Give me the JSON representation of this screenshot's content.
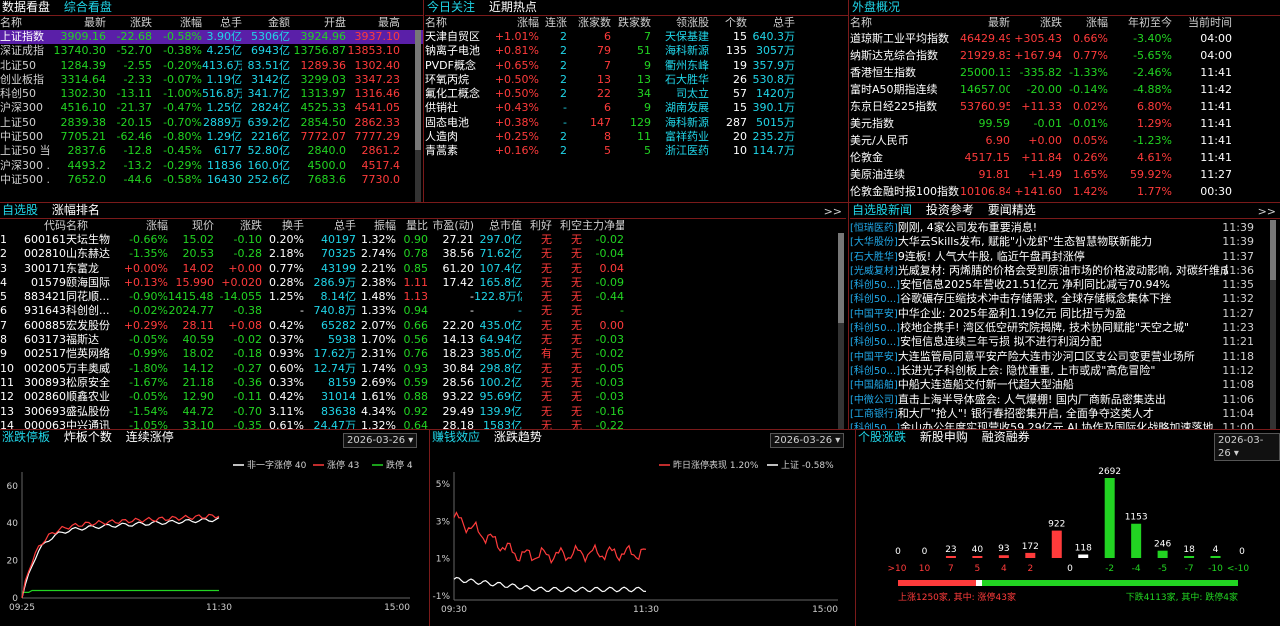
{
  "panels": {
    "overview": {
      "tabs": [
        "数据看盘",
        "综合看盘"
      ],
      "headers": [
        "名称",
        "最新",
        "涨跌",
        "涨幅",
        "总手",
        "金额",
        "开盘",
        "最高"
      ],
      "rows": [
        [
          "上证指数",
          "3909.16",
          "-22.68",
          "-0.58%",
          "3.90亿",
          "5306亿",
          "3924.96",
          "3937.10"
        ],
        [
          "深证成指",
          "13740.30",
          "-52.70",
          "-0.38%",
          "4.25亿",
          "6943亿",
          "13756.87",
          "13853.10"
        ],
        [
          "北证50",
          "1284.39",
          "-2.55",
          "-0.20%",
          "413.6万",
          "83.51亿",
          "1289.36",
          "1302.40"
        ],
        [
          "创业板指",
          "3314.64",
          "-2.33",
          "-0.07%",
          "1.19亿",
          "3142亿",
          "3299.03",
          "3347.23"
        ],
        [
          "科创50",
          "1302.30",
          "-13.11",
          "-1.00%",
          "516.8万",
          "341.7亿",
          "1313.97",
          "1316.46"
        ],
        [
          "沪深300",
          "4516.10",
          "-21.37",
          "-0.47%",
          "1.25亿",
          "2824亿",
          "4525.33",
          "4541.05"
        ],
        [
          "上证50",
          "2839.38",
          "-20.15",
          "-0.70%",
          "2889万",
          "639.2亿",
          "2854.50",
          "2862.33"
        ],
        [
          "中证500",
          "7705.21",
          "-62.46",
          "-0.80%",
          "1.29亿",
          "2216亿",
          "7772.07",
          "7777.29"
        ],
        [
          "上证50 当...",
          "2837.6",
          "-12.8",
          "-0.45%",
          "6177",
          "52.80亿",
          "2840.0",
          "2861.2"
        ],
        [
          "沪深300 ...",
          "4493.2",
          "-13.2",
          "-0.29%",
          "11836",
          "160.0亿",
          "4500.0",
          "4517.4"
        ],
        [
          "中证500 ...",
          "7652.0",
          "-44.6",
          "-0.58%",
          "16430",
          "252.6亿",
          "7683.6",
          "7730.0"
        ]
      ]
    },
    "hot": {
      "tabs": [
        "今日关注",
        "近期热点"
      ],
      "headers": [
        "名称",
        "涨幅",
        "连涨",
        "涨家数",
        "跌家数",
        "领涨股",
        "个数",
        "总手"
      ],
      "rows": [
        [
          "天津自贸区",
          "+1.01%",
          "2",
          "6",
          "7",
          "天保基建",
          "15",
          "640.3万"
        ],
        [
          "钠离子电池",
          "+0.81%",
          "2",
          "79",
          "51",
          "海科新源",
          "135",
          "3057万"
        ],
        [
          "PVDF概念",
          "+0.65%",
          "2",
          "7",
          "9",
          "衢州东峰",
          "19",
          "357.9万"
        ],
        [
          "环氧丙烷",
          "+0.50%",
          "2",
          "13",
          "13",
          "石大胜华",
          "26",
          "530.8万"
        ],
        [
          "氟化工概念",
          "+0.50%",
          "2",
          "22",
          "34",
          "司太立",
          "57",
          "1420万"
        ],
        [
          "供销社",
          "+0.43%",
          "-",
          "6",
          "9",
          "湖南发展",
          "15",
          "390.1万"
        ],
        [
          "固态电池",
          "+0.38%",
          "-",
          "147",
          "129",
          "海科新源",
          "287",
          "5015万"
        ],
        [
          "人造肉",
          "+0.25%",
          "2",
          "8",
          "11",
          "富祥药业",
          "20",
          "235.2万"
        ],
        [
          "青蒿素",
          "+0.16%",
          "2",
          "5",
          "5",
          "浙江医药",
          "10",
          "114.7万"
        ]
      ]
    },
    "global": {
      "tabs": [
        "外盘概况"
      ],
      "headers": [
        "名称",
        "最新",
        "涨跌",
        "涨幅",
        "年初至今",
        "当前时间"
      ],
      "rows": [
        [
          "道琼斯工业平均指数",
          "46429.49",
          "+305.43",
          "0.66%",
          "-3.40%",
          "04:00"
        ],
        [
          "纳斯达克综合指数",
          "21929.83",
          "+167.94",
          "0.77%",
          "-5.65%",
          "04:00"
        ],
        [
          "香港恒生指数",
          "25000.13",
          "-335.82",
          "-1.33%",
          "-2.46%",
          "11:41"
        ],
        [
          "富时A50期指连续",
          "14657.00",
          "-20.00",
          "-0.14%",
          "-4.88%",
          "11:42"
        ],
        [
          "东京日经225指数",
          "53760.95",
          "+11.33",
          "0.02%",
          "6.80%",
          "11:41"
        ],
        [
          "美元指数",
          "99.59",
          "-0.01",
          "-0.01%",
          "1.29%",
          "11:41"
        ],
        [
          "美元/人民币",
          "6.90",
          "+0.00",
          "0.05%",
          "-1.23%",
          "11:41"
        ],
        [
          "伦敦金",
          "4517.15",
          "+11.84",
          "0.26%",
          "4.61%",
          "11:41"
        ],
        [
          "美原油连续",
          "91.81",
          "+1.49",
          "1.65%",
          "59.92%",
          "11:27"
        ],
        [
          "伦敦金融时报100指数",
          "10106.84",
          "+141.60",
          "1.42%",
          "1.77%",
          "00:30"
        ]
      ]
    },
    "watch": {
      "tabs": [
        "自选股",
        "涨幅排名"
      ],
      "more": ">>",
      "headers": [
        "",
        "代码",
        "名称",
        "涨幅",
        "现价",
        "涨跌",
        "换手",
        "总手",
        "振幅",
        "量比",
        "市盈(动)",
        "总市值",
        "利好",
        "利空",
        "主力净量"
      ],
      "rows": [
        [
          "1",
          "600161",
          "天坛生物",
          "-0.66%",
          "15.02",
          "-0.10",
          "0.20%",
          "40197",
          "1.32%",
          "0.90",
          "27.21",
          "297.0亿",
          "无",
          "无",
          "-0.02"
        ],
        [
          "2",
          "002810",
          "山东赫达",
          "-1.35%",
          "20.53",
          "-0.28",
          "2.18%",
          "70325",
          "2.74%",
          "0.78",
          "38.56",
          "71.62亿",
          "无",
          "无",
          "-0.04"
        ],
        [
          "3",
          "300171",
          "东富龙",
          "+0.00%",
          "14.02",
          "+0.00",
          "0.77%",
          "43199",
          "2.21%",
          "0.85",
          "61.20",
          "107.4亿",
          "无",
          "无",
          "0.04"
        ],
        [
          "4",
          "01579",
          "颐海国际",
          "+0.13%",
          "15.990",
          "+0.020",
          "0.28%",
          "286.9万",
          "2.38%",
          "1.11",
          "17.42",
          "165.8亿",
          "无",
          "无",
          "-0.09"
        ],
        [
          "5",
          "883421",
          "同花顺...",
          "-0.90%",
          "1415.484",
          "-14.055",
          "1.25%",
          "8.14亿",
          "1.48%",
          "1.13",
          "-",
          "122.8万亿",
          "无",
          "无",
          "-0.44"
        ],
        [
          "6",
          "931643",
          "科创创...",
          "-0.02%",
          "2024.77",
          "-0.38",
          "-",
          "740.8万",
          "1.33%",
          "0.94",
          "-",
          "-",
          "无",
          "无",
          "-"
        ],
        [
          "7",
          "600885",
          "宏发股份",
          "+0.29%",
          "28.11",
          "+0.08",
          "0.42%",
          "65282",
          "2.07%",
          "0.66",
          "22.20",
          "435.0亿",
          "无",
          "无",
          "0.00"
        ],
        [
          "8",
          "603173",
          "福斯达",
          "-0.05%",
          "40.59",
          "-0.02",
          "0.37%",
          "5938",
          "1.70%",
          "0.56",
          "14.13",
          "64.94亿",
          "无",
          "无",
          "-0.03"
        ],
        [
          "9",
          "002517",
          "恺英网络",
          "-0.99%",
          "18.02",
          "-0.18",
          "0.93%",
          "17.62万",
          "2.31%",
          "0.76",
          "18.23",
          "385.0亿",
          "有",
          "无",
          "-0.02"
        ],
        [
          "10",
          "002005",
          "万丰奥威",
          "-1.80%",
          "14.12",
          "-0.27",
          "0.60%",
          "12.74万",
          "1.74%",
          "0.93",
          "30.84",
          "298.8亿",
          "无",
          "无",
          "-0.05"
        ],
        [
          "11",
          "300893",
          "松原安全",
          "-1.67%",
          "21.18",
          "-0.36",
          "0.33%",
          "8159",
          "2.69%",
          "0.59",
          "28.56",
          "100.2亿",
          "无",
          "无",
          "-0.03"
        ],
        [
          "12",
          "002860",
          "顺鑫农业",
          "-0.05%",
          "12.90",
          "-0.11",
          "0.42%",
          "31014",
          "1.61%",
          "0.88",
          "93.22",
          "95.69亿",
          "无",
          "无",
          "-0.03"
        ],
        [
          "13",
          "300693",
          "盛弘股份",
          "-1.54%",
          "44.72",
          "-0.70",
          "3.11%",
          "83638",
          "4.34%",
          "0.92",
          "29.49",
          "139.9亿",
          "无",
          "无",
          "-0.16"
        ],
        [
          "14",
          "000063",
          "中兴通讯",
          "-1.05%",
          "33.10",
          "-0.35",
          "0.61%",
          "24.47万",
          "1.32%",
          "0.64",
          "28.18",
          "1583亿",
          "无",
          "无",
          "-0.22"
        ]
      ]
    },
    "news": {
      "tabs": [
        "自选股新闻",
        "投资参考",
        "要闻精选"
      ],
      "more": ">>",
      "rows": [
        [
          "[恒瑞医药]",
          "刚刚, 4家公司发布重要消息!",
          "11:39"
        ],
        [
          "[大华股份]",
          "大华云Skills发布, 赋能\"小龙虾\"生态智慧物联新能力",
          "11:39"
        ],
        [
          "[石大胜华]",
          "9连板! 人气大牛股, 临近午盘再封涨停",
          "11:37"
        ],
        [
          "[光威复材]",
          "光威复材: 丙烯腈的价格会受到原油市场的价格波动影响, 对碳纤维成本控...",
          "11:36"
        ],
        [
          "[科创50...]",
          "安恒信息2025年营收21.51亿元 净利同比减亏70.94%",
          "11:35"
        ],
        [
          "[科创50...]",
          "谷歌碾存压缩技术冲击存储需求, 全球存储概念集体下挫",
          "11:32"
        ],
        [
          "[中国平安]",
          "中华企业: 2025年盈利1.19亿元 同比扭亏为盈",
          "11:27"
        ],
        [
          "[科创50...]",
          "校地企携手! 湾区低空研究院揭牌, 技术协同赋能\"天空之城\"",
          "11:23"
        ],
        [
          "[科创50...]",
          "安恒信息连续三年亏损 拟不进行利润分配",
          "11:21"
        ],
        [
          "[中国平安]",
          "大连监管局同意平安产险大连市沙河口区支公司变更营业场所",
          "11:18"
        ],
        [
          "[科创50...]",
          "长进光子科创板上会: 隐忧重重, 上市或成\"高危冒险\"",
          "11:12"
        ],
        [
          "[中国船舶]",
          "中船大连造船交付新一代超大型油船",
          "11:08"
        ],
        [
          "[中微公司]",
          "直击上海半导体盛会: 人气爆棚! 国内厂商新品密集迭出",
          "11:06"
        ],
        [
          "[工商银行]",
          "和大厂\"抢人\"! 银行春招密集开启, 全面争夺这类人才",
          "11:04"
        ],
        [
          "[科创50...]",
          "金山办公年度实现营收59.29亿元 AI 协作及国际化战略加速落地",
          "11:00"
        ]
      ]
    },
    "limit": {
      "tabs": [
        "涨跌停板",
        "炸板个数",
        "连续涨停"
      ],
      "date": "2026-03-26",
      "legend": [
        {
          "name": "非一字涨停 40",
          "color": "#ffffff"
        },
        {
          "name": "涨停 43",
          "color": "#ff3b3b"
        },
        {
          "name": "跌停 4",
          "color": "#22d422"
        }
      ],
      "yticks": [
        "60",
        "40",
        "20",
        "0"
      ],
      "xticks": [
        "09:25",
        "11:30",
        "15:00"
      ]
    },
    "effect": {
      "tabs": [
        "赚钱效应",
        "涨跌趋势"
      ],
      "date": "2026-03-26",
      "legend": [
        {
          "name": "昨日涨停表现 1.20%",
          "color": "#ff3b3b"
        },
        {
          "name": "上证 -0.58%",
          "color": "#ffffff"
        }
      ],
      "yticks": [
        "5%",
        "3%",
        "1%",
        "-1%"
      ],
      "xticks": [
        "09:30",
        "11:30",
        "15:00"
      ]
    },
    "dist": {
      "tabs": [
        "个股涨跌",
        "新股申购",
        "融资融券"
      ],
      "date": "2026-03-26",
      "bars": [
        {
          "v": 0,
          "c": "#ff3b3b"
        },
        {
          "v": 0,
          "c": "#ff3b3b"
        },
        {
          "v": 23,
          "c": "#ff3b3b"
        },
        {
          "v": 40,
          "c": "#ff3b3b"
        },
        {
          "v": 93,
          "c": "#ff3b3b"
        },
        {
          "v": 172,
          "c": "#ff3b3b"
        },
        {
          "v": 922,
          "c": "#ff3b3b"
        },
        {
          "v": 118,
          "c": "#ffffff"
        },
        {
          "v": 2692,
          "c": "#22d422"
        },
        {
          "v": 1153,
          "c": "#22d422"
        },
        {
          "v": 246,
          "c": "#22d422"
        },
        {
          "v": 18,
          "c": "#22d422"
        },
        {
          "v": 4,
          "c": "#22d422"
        },
        {
          "v": 0,
          "c": "#22d422"
        }
      ],
      "labels": [
        ">10",
        "10",
        "7",
        "5",
        "4",
        "2",
        "0",
        "-2",
        "-4",
        "-5",
        "-7",
        "-10",
        "<-10"
      ],
      "up_text": "上涨1250家, 其中: 涨停43家",
      "down_text": "下跌4113家, 其中: 跌停4家"
    }
  }
}
